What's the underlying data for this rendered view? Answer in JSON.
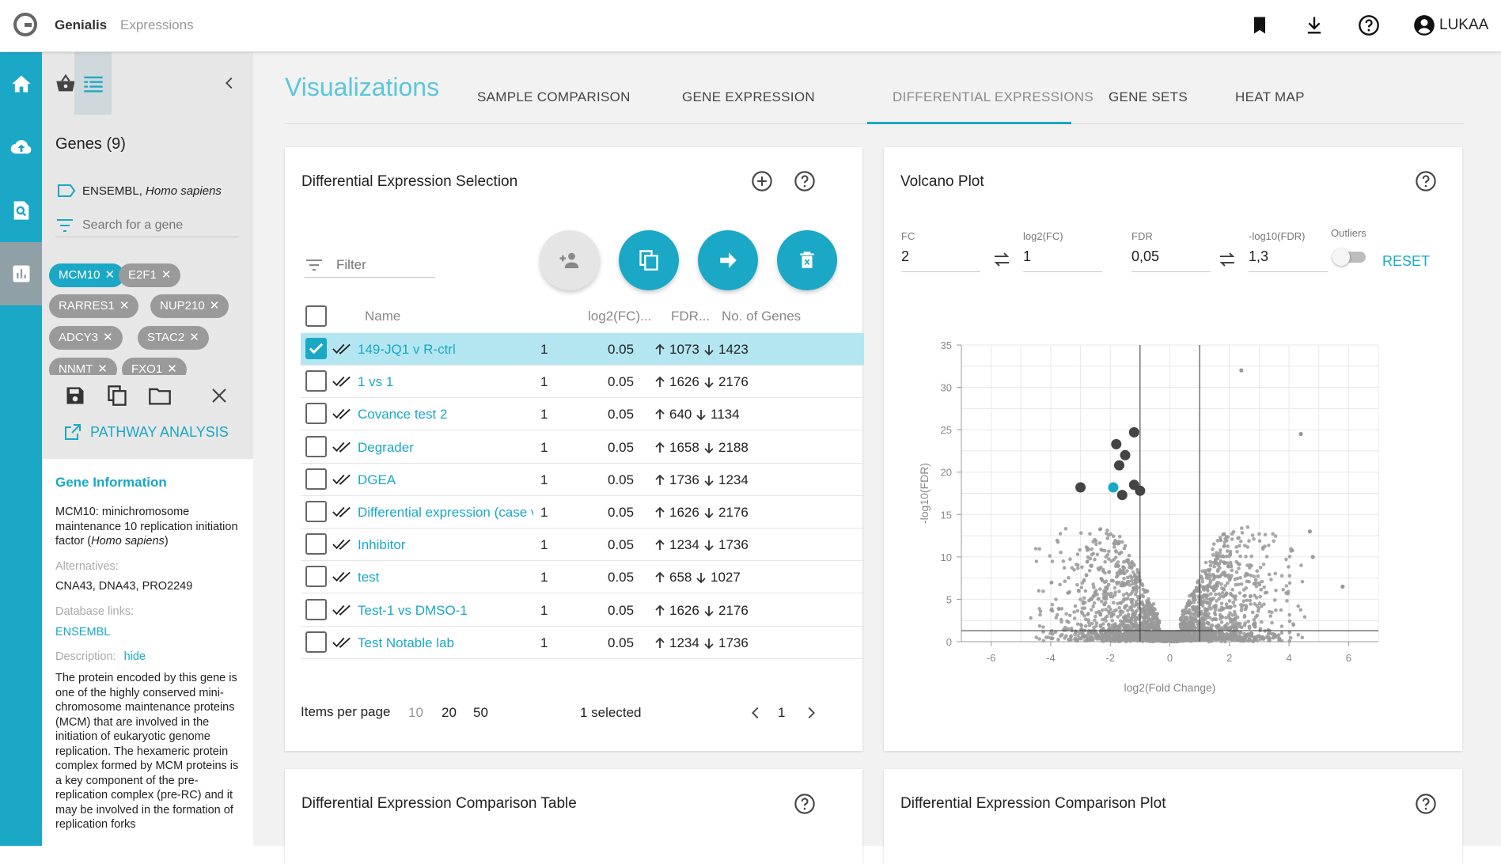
{
  "app": {
    "brand": "Genialis",
    "breadcrumb": "Expressions",
    "user": "LUKAA"
  },
  "sidebar": {
    "genes_title": "Genes (9)",
    "source_text": "ENSEMBL, ",
    "source_species": "Homo sapiens",
    "search_placeholder": "Search for a gene",
    "chips": [
      {
        "label": "MCM10",
        "active": true
      },
      {
        "label": "E2F1",
        "active": false
      },
      {
        "label": "RARRES1",
        "active": false
      },
      {
        "label": "NUP210",
        "active": false
      },
      {
        "label": "ADCY3",
        "active": false
      },
      {
        "label": "STAC2",
        "active": false
      },
      {
        "label": "NNMT",
        "active": false
      },
      {
        "label": "FXO1",
        "active": false
      }
    ],
    "pathway_label": "PATHWAY ANALYSIS"
  },
  "gene_info": {
    "title": "Gene Information",
    "summary_pre": "MCM10: minichromosome maintenance 10 replication initiation factor (",
    "summary_species": "Homo sapiens",
    "summary_post": ")",
    "alternatives_label": "Alternatives:",
    "alternatives": "CNA43, DNA43, PRO2249",
    "db_label": "Database links:",
    "db_link": "ENSEMBL",
    "description_label": "Description:",
    "description_toggle": "hide",
    "description": "The protein encoded by this gene is one of the highly conserved mini-chromosome maintenance proteins (MCM) that are involved in the initiation of eukaryotic genome replication. The hexameric protein complex formed by MCM proteins is a key component of the pre-replication complex (pre-RC) and it may be involved in the formation of replication forks"
  },
  "main": {
    "title": "Visualizations",
    "tabs": [
      {
        "label": "SAMPLE COMPARISON"
      },
      {
        "label": "GENE EXPRESSION"
      },
      {
        "label": "DIFFERENTIAL EXPRESSIONS"
      },
      {
        "label": "GENE SETS"
      },
      {
        "label": "HEAT MAP"
      }
    ],
    "active_tab": "DIFFERENTIAL EXPRESSIONS"
  },
  "de_selection": {
    "title": "Differential Expression Selection",
    "filter_placeholder": "Filter",
    "columns": [
      "Name",
      "log2(FC)...",
      "FDR...",
      "No. of Genes"
    ],
    "rows": [
      {
        "name": "149-JQ1 v R-ctrl",
        "fc": "1",
        "fdr": "0.05",
        "up": "1073",
        "down": "1423",
        "checked": true
      },
      {
        "name": "1 vs 1",
        "fc": "1",
        "fdr": "0.05",
        "up": "1626",
        "down": "2176",
        "checked": false
      },
      {
        "name": "Covance test 2",
        "fc": "1",
        "fdr": "0.05",
        "up": "640",
        "down": "1134",
        "checked": false
      },
      {
        "name": "Degrader",
        "fc": "1",
        "fdr": "0.05",
        "up": "1658",
        "down": "2188",
        "checked": false
      },
      {
        "name": "DGEA",
        "fc": "1",
        "fdr": "0.05",
        "up": "1736",
        "down": "1234",
        "checked": false
      },
      {
        "name": "Differential expression (case vs",
        "fc": "1",
        "fdr": "0.05",
        "up": "1626",
        "down": "2176",
        "checked": false
      },
      {
        "name": "Inhibitor",
        "fc": "1",
        "fdr": "0.05",
        "up": "1234",
        "down": "1736",
        "checked": false
      },
      {
        "name": "test",
        "fc": "1",
        "fdr": "0.05",
        "up": "658",
        "down": "1027",
        "checked": false
      },
      {
        "name": "Test-1 vs DMSO-1",
        "fc": "1",
        "fdr": "0.05",
        "up": "1626",
        "down": "2176",
        "checked": false
      },
      {
        "name": "Test Notable lab",
        "fc": "1",
        "fdr": "0.05",
        "up": "1234",
        "down": "1736",
        "checked": false
      }
    ],
    "pager": {
      "items_label": "Items per page",
      "sizes": [
        "10",
        "20",
        "50"
      ],
      "selected_text": "1 selected",
      "page": "1"
    }
  },
  "volcano": {
    "title": "Volcano Plot",
    "fields": {
      "fc_label": "FC",
      "fc_value": "2",
      "log2fc_label": "log2(FC)",
      "log2fc_value": "1",
      "fdr_label": "FDR",
      "fdr_value": "0,05",
      "log10fdr_label": "-log10(FDR)",
      "log10fdr_value": "1,3",
      "outliers_label": "Outliers"
    },
    "reset_label": "RESET",
    "colors": {
      "gray": "#999999",
      "dark": "#444444",
      "highlight": "#1aa8c6"
    }
  },
  "chart_data": {
    "type": "scatter",
    "xlabel": "log2(Fold Change)",
    "ylabel": "-log10(FDR)",
    "xlim": [
      -7,
      7
    ],
    "ylim": [
      0,
      35
    ],
    "xticks": [
      -6,
      -4,
      -2,
      0,
      2,
      4,
      6
    ],
    "yticks": [
      0,
      5,
      10,
      15,
      20,
      25,
      30,
      35
    ],
    "grid": true,
    "thresholds": {
      "x": [
        -1,
        1
      ],
      "y": 1.3
    },
    "highlighted_points": [
      {
        "x": -1.2,
        "y": 24.7,
        "group": "selected-genes"
      },
      {
        "x": -1.8,
        "y": 23.3,
        "group": "selected-genes"
      },
      {
        "x": -1.5,
        "y": 22.0,
        "group": "selected-genes"
      },
      {
        "x": -1.7,
        "y": 20.8,
        "group": "selected-genes"
      },
      {
        "x": -1.2,
        "y": 18.5,
        "group": "selected-genes"
      },
      {
        "x": -1.0,
        "y": 17.8,
        "group": "selected-genes"
      },
      {
        "x": -1.6,
        "y": 17.3,
        "group": "selected-genes"
      },
      {
        "x": -3.0,
        "y": 18.2,
        "group": "selected-genes"
      },
      {
        "x": -1.9,
        "y": 18.2,
        "group": "active-gene"
      }
    ],
    "outlier_points": [
      {
        "x": 2.4,
        "y": 32.0
      },
      {
        "x": 4.4,
        "y": 24.5
      },
      {
        "x": 4.7,
        "y": 13.0
      },
      {
        "x": 4.8,
        "y": 10.0
      },
      {
        "x": 5.8,
        "y": 6.5
      }
    ]
  },
  "bottom_cards": {
    "comparison_table_title": "Differential Expression Comparison Table",
    "comparison_plot_title": "Differential Expression Comparison Plot"
  }
}
